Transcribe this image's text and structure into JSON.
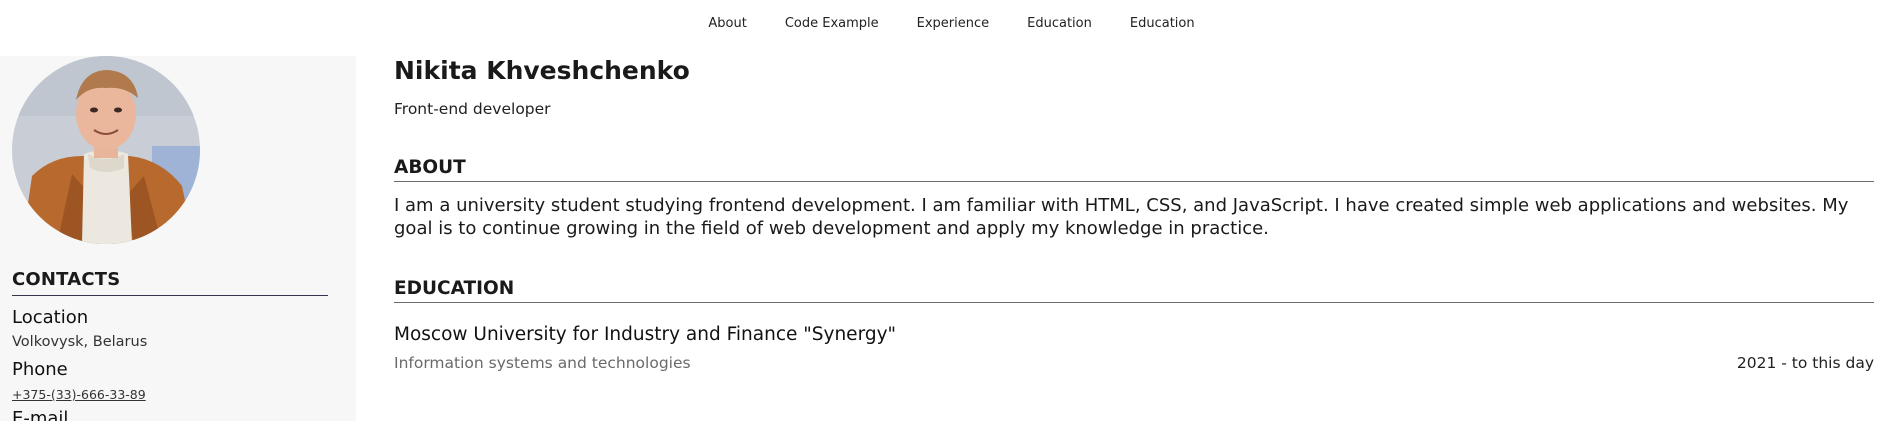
{
  "nav": {
    "items": [
      "About",
      "Code Example",
      "Experience",
      "Education",
      "Education"
    ]
  },
  "profile": {
    "name": "Nikita Khveshchenko",
    "role": "Front-end developer"
  },
  "contacts": {
    "title": "CONTACTS",
    "location_label": "Location",
    "location_value": "Volkovysk, Belarus",
    "phone_label": "Phone",
    "phone_value": "+375-(33)-666-33-89",
    "email_label": "E-mail"
  },
  "about": {
    "title": "ABOUT",
    "text": "I am a university student studying frontend development. I am familiar with HTML, CSS, and JavaScript. I have created simple web applications and websites. My goal is to continue growing in the field of web development and apply my knowledge in practice."
  },
  "education": {
    "title": "EDUCATION",
    "school": "Moscow University for Industry and Finance \"Synergy\"",
    "field": "Information systems and technologies",
    "years": "2021 - to this day"
  },
  "colors": {
    "sidebar_bg": "#f7f7f7",
    "accent_line": "#34344a",
    "muted_text": "#6a6a6a"
  }
}
